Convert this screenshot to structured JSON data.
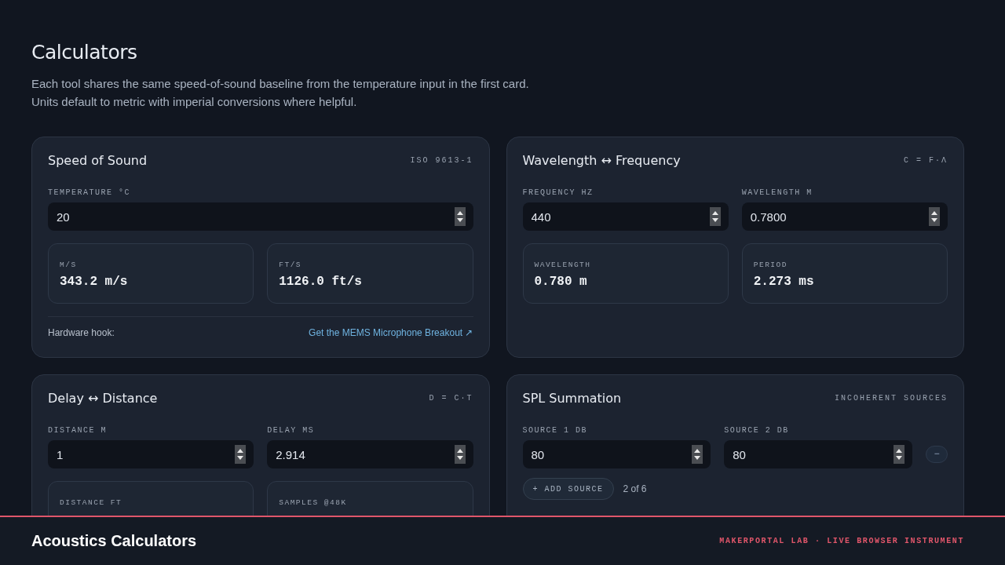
{
  "header": {
    "title": "Calculators",
    "description": [
      "Each tool shares the same speed-of-sound baseline from the temperature input in the first card.",
      "Units default to metric with imperial conversions where helpful."
    ]
  },
  "cards": [
    {
      "kind": "converter",
      "title": "Speed of Sound",
      "tag": "ISO 9613-1",
      "inputs": [
        {
          "label": "TEMPERATURE °C",
          "value": "20"
        }
      ],
      "results": [
        {
          "label": "M/S",
          "value": "343.2 m/s"
        },
        {
          "label": "FT/S",
          "value": "1126.0 ft/s"
        }
      ],
      "hook": {
        "label": "Hardware hook:",
        "link": "Get the MEMS Microphone Breakout ↗"
      }
    },
    {
      "kind": "converter",
      "title": "Wavelength ↔ Frequency",
      "tag": "C = F·Λ",
      "inputs": [
        {
          "label": "FREQUENCY HZ",
          "value": "440"
        },
        {
          "label": "WAVELENGTH M",
          "value": "0.7800"
        }
      ],
      "results": [
        {
          "label": "WAVELENGTH",
          "value": "0.780 m"
        },
        {
          "label": "PERIOD",
          "value": "2.273 ms"
        }
      ]
    },
    {
      "kind": "converter",
      "title": "Delay ↔ Distance",
      "tag": "D = C·T",
      "inputs": [
        {
          "label": "DISTANCE M",
          "value": "1"
        },
        {
          "label": "DELAY MS",
          "value": "2.914"
        }
      ],
      "results": [
        {
          "label": "DISTANCE FT"
        },
        {
          "label": "SAMPLES @48K"
        }
      ]
    },
    {
      "kind": "sum",
      "title": "SPL Summation",
      "tag": "INCOHERENT SOURCES",
      "inputs": [
        {
          "label": "SOURCE 1 DB",
          "value": "80"
        },
        {
          "label": "SOURCE 2 DB",
          "value": "80"
        }
      ],
      "remove": "−",
      "add": "+ ADD SOURCE",
      "count": "2 of 6"
    }
  ],
  "footer": {
    "title": "Acoustics Calculators",
    "tagline": "MAKERPORTAL LAB · LIVE BROWSER INSTRUMENT"
  }
}
